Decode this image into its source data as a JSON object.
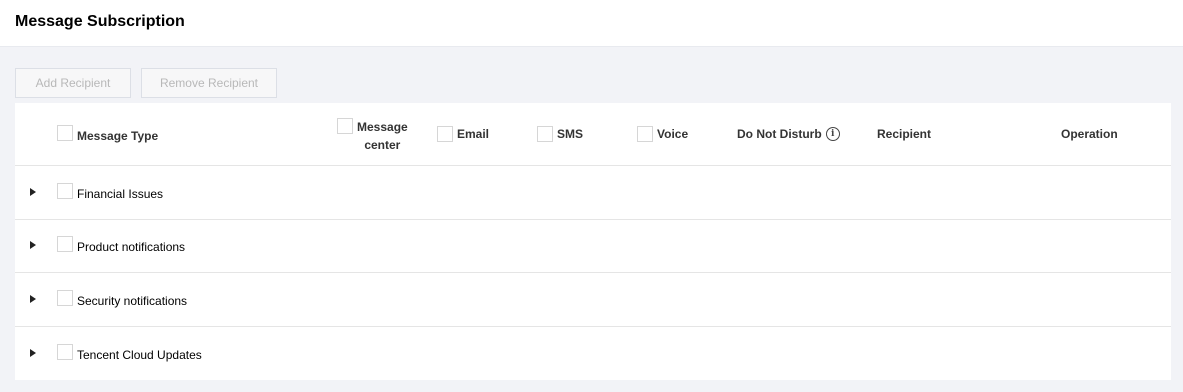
{
  "page": {
    "title": "Message Subscription"
  },
  "toolbar": {
    "add_label": "Add Recipient",
    "remove_label": "Remove Recipient"
  },
  "table": {
    "headers": {
      "message_type": "Message Type",
      "message_center_line1": "Message",
      "message_center_line2": "center",
      "email": "Email",
      "sms": "SMS",
      "voice": "Voice",
      "do_not_disturb": "Do Not Disturb",
      "recipient": "Recipient",
      "operation": "Operation"
    },
    "rows": [
      {
        "label": "Financial Issues"
      },
      {
        "label": "Product notifications"
      },
      {
        "label": "Security notifications"
      },
      {
        "label": "Tencent Cloud Updates"
      }
    ]
  },
  "icons": {
    "expand": "caret-right-icon",
    "info": "info-circle-icon"
  },
  "colors": {
    "background": "#f2f3f7",
    "panel": "#ffffff",
    "disabled_text": "#b8b8b8",
    "border": "#e5e5e5"
  }
}
